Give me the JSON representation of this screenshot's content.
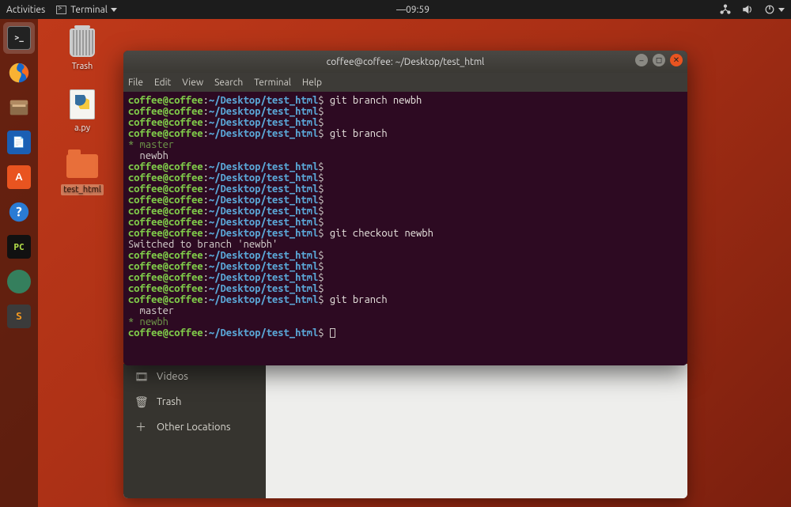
{
  "top_panel": {
    "activities": "Activities",
    "app_indicator": "Terminal",
    "clock": "09:59"
  },
  "desktop": {
    "trash_label": "Trash",
    "apy_label": "a.py",
    "folder_label": "test_html"
  },
  "files_window": {
    "sidebar": {
      "videos": "Videos",
      "trash": "Trash",
      "other_locations": "Other Locations"
    }
  },
  "terminal": {
    "title": "coffee@coffee: ~/Desktop/test_html",
    "menu": {
      "file": "File",
      "edit": "Edit",
      "view": "View",
      "search": "Search",
      "terminal": "Terminal",
      "help": "Help"
    },
    "prompt": {
      "userhost": "coffee@coffee",
      "sep": ":",
      "path": "~/Desktop/test_html",
      "sigil": "$"
    },
    "lines": {
      "cmd_git_branch_newbh": "git branch newbh",
      "cmd_git_branch": "git branch",
      "out_star_master": "* master",
      "out_newbh": "  newbh",
      "cmd_git_checkout_newbh": "git checkout newbh",
      "out_switched": "Switched to branch 'newbh'",
      "out_master": "  master",
      "out_star_newbh": "* newbh"
    }
  }
}
